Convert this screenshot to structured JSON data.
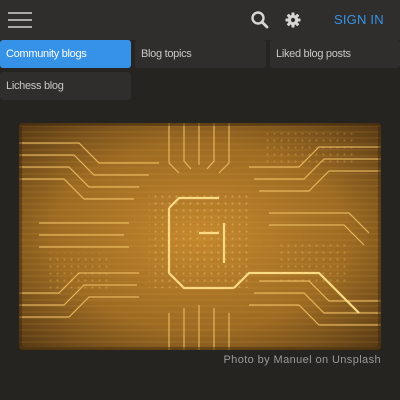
{
  "header": {
    "menu_icon": "hamburger-menu-icon",
    "search_icon": "search-icon",
    "settings_icon": "gear-icon",
    "signin_label": "SIGN IN"
  },
  "subnav": {
    "items": [
      {
        "label": "Community blogs",
        "active": true
      },
      {
        "label": "Blog topics",
        "active": false
      },
      {
        "label": "Liked blog posts",
        "active": false
      },
      {
        "label": "Lichess blog",
        "active": false
      }
    ]
  },
  "hero": {
    "image_icon": "circuit-board-photo",
    "credit": "Photo by Manuel on Unsplash"
  },
  "colors": {
    "background": "#262421",
    "bar": "#302e2c",
    "accent": "#3692e7",
    "circuit_gold": "#c8912f"
  }
}
